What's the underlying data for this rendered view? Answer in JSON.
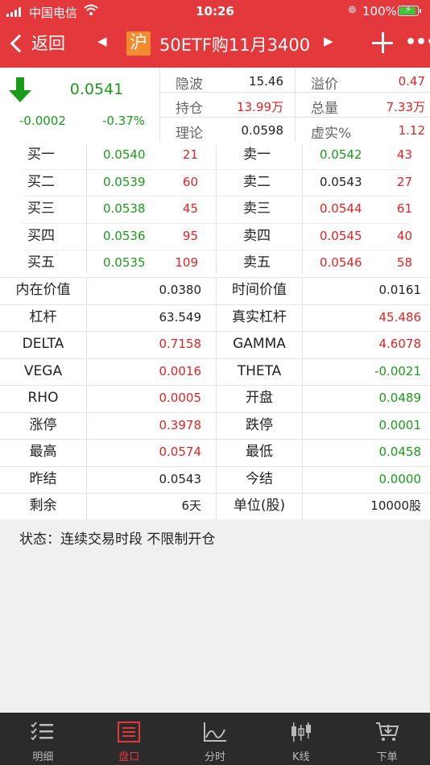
{
  "status_bar": {
    "carrier": "中国电信",
    "time": "10:26",
    "battery_pct": "100%"
  },
  "nav": {
    "back_label": "返回",
    "exchange_badge": "沪",
    "title": "50ETF购11月3400",
    "prev_arrow": "◀",
    "next_arrow": "▶",
    "more": "•••"
  },
  "summary": {
    "last_price": "0.0541",
    "change": "-0.0002",
    "change_pct": "-0.37%",
    "stats": [
      {
        "label": "隐波",
        "value": "15.46",
        "color": "black"
      },
      {
        "label": "溢价",
        "value": "0.47",
        "color": "red"
      },
      {
        "label": "持仓",
        "value": "13.99万",
        "color": "red"
      },
      {
        "label": "总量",
        "value": "7.33万",
        "color": "red"
      },
      {
        "label": "理论",
        "value": "0.0598",
        "color": "black"
      },
      {
        "label": "虚实%",
        "value": "1.12",
        "color": "red"
      }
    ]
  },
  "order_book": {
    "bids": [
      {
        "label": "买一",
        "price": "0.0540",
        "qty": "21"
      },
      {
        "label": "买二",
        "price": "0.0539",
        "qty": "60"
      },
      {
        "label": "买三",
        "price": "0.0538",
        "qty": "45"
      },
      {
        "label": "买四",
        "price": "0.0536",
        "qty": "95"
      },
      {
        "label": "买五",
        "price": "0.0535",
        "qty": "109"
      }
    ],
    "asks": [
      {
        "label": "卖一",
        "price": "0.0542",
        "qty": "43",
        "price_color": "green"
      },
      {
        "label": "卖二",
        "price": "0.0543",
        "qty": "27",
        "price_color": "black"
      },
      {
        "label": "卖三",
        "price": "0.0544",
        "qty": "61",
        "price_color": "red"
      },
      {
        "label": "卖四",
        "price": "0.0545",
        "qty": "40",
        "price_color": "red"
      },
      {
        "label": "卖五",
        "price": "0.0546",
        "qty": "58",
        "price_color": "red"
      }
    ]
  },
  "greeks": [
    {
      "l1": "内在价值",
      "v1": "0.0380",
      "c1": "black",
      "l2": "时间价值",
      "v2": "0.0161",
      "c2": "black"
    },
    {
      "l1": "杠杆",
      "v1": "63.549",
      "c1": "black",
      "l2": "真实杠杆",
      "v2": "45.486",
      "c2": "red"
    },
    {
      "l1": "DELTA",
      "v1": "0.7158",
      "c1": "red",
      "l2": "GAMMA",
      "v2": "4.6078",
      "c2": "red"
    },
    {
      "l1": "VEGA",
      "v1": "0.0016",
      "c1": "red",
      "l2": "THETA",
      "v2": "-0.0021",
      "c2": "green"
    },
    {
      "l1": "RHO",
      "v1": "0.0005",
      "c1": "red",
      "l2": "开盘",
      "v2": "0.0489",
      "c2": "green"
    },
    {
      "l1": "涨停",
      "v1": "0.3978",
      "c1": "red",
      "l2": "跌停",
      "v2": "0.0001",
      "c2": "green"
    },
    {
      "l1": "最高",
      "v1": "0.0574",
      "c1": "red",
      "l2": "最低",
      "v2": "0.0458",
      "c2": "green"
    },
    {
      "l1": "昨结",
      "v1": "0.0543",
      "c1": "black",
      "l2": "今结",
      "v2": "0.0000",
      "c2": "green"
    },
    {
      "l1": "剩余",
      "v1": "6天",
      "c1": "black",
      "l2": "单位(股)",
      "v2": "10000股",
      "c2": "black"
    }
  ],
  "status_line": "状态：连续交易时段  不限制开仓",
  "tabs": [
    {
      "label": "明细",
      "icon": "list-check-icon",
      "active": false
    },
    {
      "label": "盘口",
      "icon": "order-book-icon",
      "active": true
    },
    {
      "label": "分时",
      "icon": "line-chart-icon",
      "active": false
    },
    {
      "label": "K线",
      "icon": "candlestick-icon",
      "active": false
    },
    {
      "label": "下单",
      "icon": "cart-icon",
      "active": false
    }
  ],
  "colors": {
    "brand_red": "#e4393c",
    "up_red": "#e02424",
    "down_green": "#1a9c1a",
    "badge_orange": "#f28a2e",
    "tabbar_bg": "#2b2b2b"
  }
}
